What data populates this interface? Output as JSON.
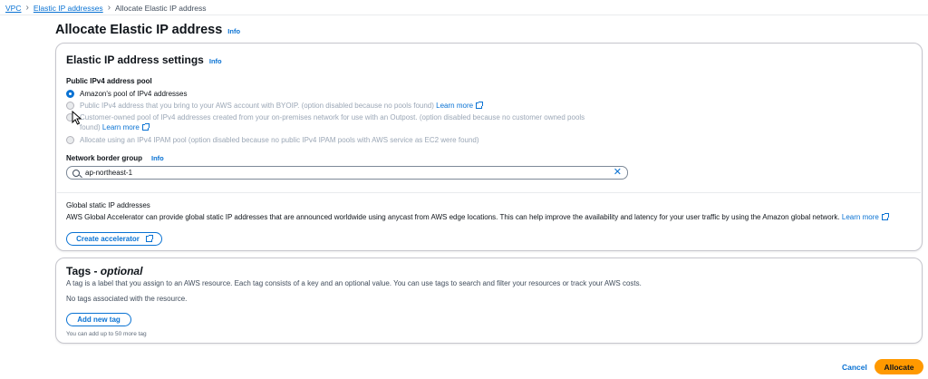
{
  "breadcrumb": {
    "items": [
      "VPC",
      "Elastic IP addresses"
    ],
    "current": "Allocate Elastic IP address"
  },
  "page": {
    "title": "Allocate Elastic IP address",
    "info": "Info"
  },
  "settings": {
    "title": "Elastic IP address settings",
    "info": "Info",
    "pool_label": "Public IPv4 address pool",
    "options": [
      {
        "text": "Amazon's pool of IPv4 addresses",
        "link": "",
        "selected": true,
        "disabled": false
      },
      {
        "text": "Public IPv4 address that you bring to your AWS account with BYOIP. (option disabled because no pools found)",
        "link": "Learn more",
        "selected": false,
        "disabled": true
      },
      {
        "text": "Customer-owned pool of IPv4 addresses created from your on-premises network for use with an Outpost. (option disabled because no customer owned pools",
        "text2": "found)",
        "link": "Learn more",
        "selected": false,
        "disabled": true
      },
      {
        "text": "Allocate using an IPv4 IPAM pool (option disabled because no public IPv4 IPAM pools with AWS service as EC2 were found)",
        "link": "",
        "selected": false,
        "disabled": true
      }
    ],
    "border_group_label": "Network border group",
    "border_group_info": "Info",
    "border_group_value": "ap-northeast-1",
    "global_title": "Global static IP addresses",
    "global_desc": "AWS Global Accelerator can provide global static IP addresses that are announced worldwide using anycast from AWS edge locations. This can help improve the availability and latency for your user traffic by using the Amazon global network.",
    "global_link": "Learn more",
    "create_accelerator": "Create accelerator"
  },
  "tags": {
    "title": "Tags - ",
    "title_optional": "optional",
    "description": "A tag is a label that you assign to an AWS resource. Each tag consists of a key and an optional value. You can use tags to search and filter your resources or track your AWS costs.",
    "empty": "No tags associated with the resource.",
    "add_button": "Add new tag",
    "hint": "You can add up to 50 more tag"
  },
  "footer": {
    "cancel": "Cancel",
    "allocate": "Allocate"
  },
  "colors": {
    "primary_link": "#0972d3",
    "action_orange": "#ff9900"
  }
}
